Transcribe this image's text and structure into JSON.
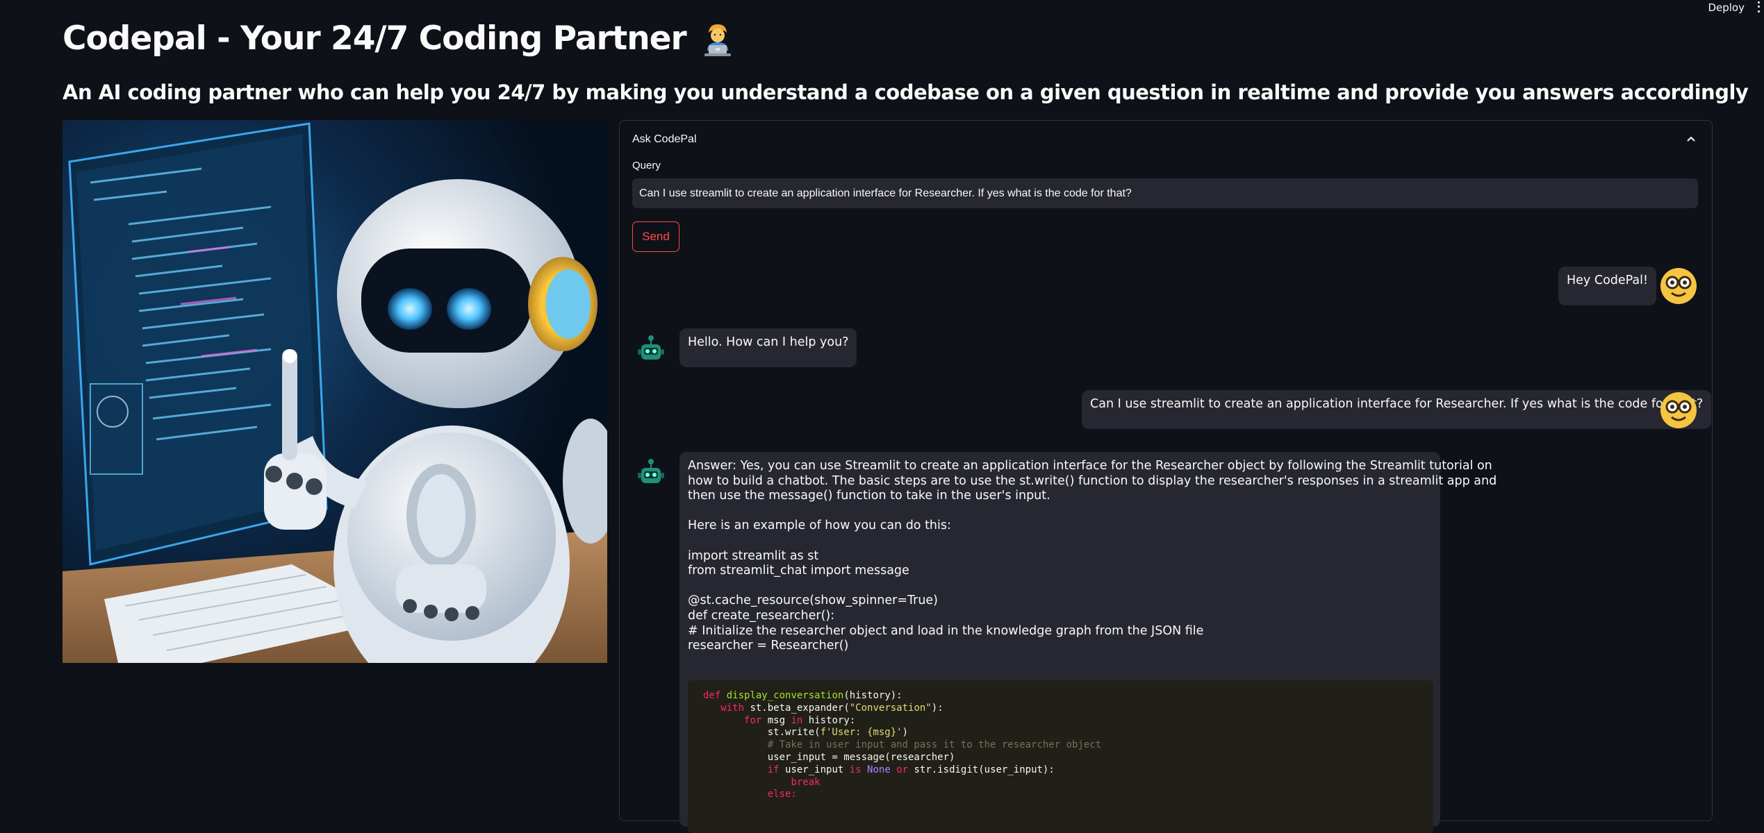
{
  "topbar": {
    "deploy_label": "Deploy"
  },
  "header": {
    "title": "Codepal - Your 24/7 Coding Partner",
    "subtitle": "An AI coding partner who can help you 24/7 by making you understand a codebase on a given question in realtime and provide you answers accordingly"
  },
  "expander": {
    "label": "Ask CodePal",
    "query_label": "Query",
    "query_value": "Can I use streamlit to create an application interface for Researcher. If yes what is the code for that?",
    "send_label": "Send"
  },
  "chat": {
    "user_1": "Hey CodePal!",
    "bot_1": "Hello. How can I help you?",
    "user_2": "Can I use streamlit to create an application interface for Researcher. If yes what is the code for that?",
    "bot_2": {
      "line1": "Answer: Yes, you can use Streamlit to create an application interface for the Researcher object by following the Streamlit tutorial on",
      "line2": "how to build a chatbot. The basic steps are to use the st.write() function to display the researcher's responses in a streamlit app and",
      "line3": "then use the message() function to take in the user's input.",
      "line4": "Here is an example of how you can do this:",
      "line5": "import streamlit as st",
      "line6": "from streamlit_chat import message",
      "line7": "@st.cache_resource(show_spinner=True)",
      "line8": "def create_researcher():",
      "line9": "# Initialize the researcher object and load in the knowledge graph from the JSON file",
      "line10": "researcher = Researcher()"
    }
  },
  "code": {
    "c1": "def",
    "c2": "display_conversation",
    "c3": "(history):",
    "c4": "with",
    "c5": "st.beta_expander(",
    "c6": "\"Conversation\"",
    "c7": "):",
    "c8": "for",
    "c9": "msg",
    "c10": "in",
    "c11": "history:",
    "c12": "st.write(",
    "c13": "f'User: {msg}'",
    "c14": ")",
    "c15": "# Take in user input and pass it to the researcher object",
    "c16": "user_input = message(researcher)",
    "c17": "if",
    "c18": "user_input",
    "c19": "is",
    "c20": "None",
    "c21": "or",
    "c22": "str.isdigit(user_input):",
    "c23": "break",
    "c24": "else:"
  },
  "colors": {
    "background": "#0e1117",
    "accent": "#ff4b4b",
    "bubble": "#262730",
    "code_bg": "#202018"
  },
  "icons": [
    "chevron-up-icon",
    "user-avatar-icon",
    "bot-avatar-icon",
    "kebab-menu-icon",
    "technologist-emoji"
  ]
}
